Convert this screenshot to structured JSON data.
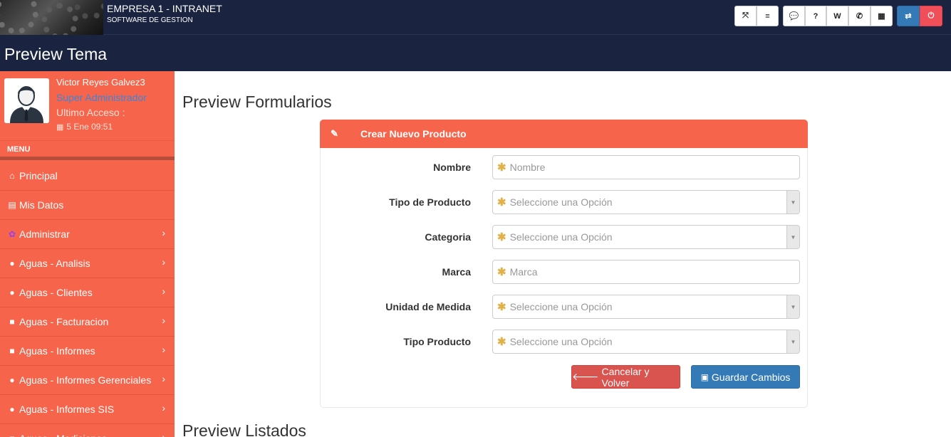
{
  "header": {
    "company": "EMPRESA 1 - INTRANET",
    "subtitle": "SOFTWARE DE GESTION",
    "page_title": "Preview Tema"
  },
  "toolbar": [
    {
      "name": "fullscreen-button",
      "icon": "expand-icon",
      "glyph": "⤧"
    },
    {
      "name": "menu-toggle-button",
      "icon": "hamburger-icon",
      "glyph": "≡"
    },
    {
      "name": "messages-button",
      "icon": "chat-icon",
      "glyph": "💬"
    },
    {
      "name": "help-button",
      "icon": "question-icon",
      "glyph": "?"
    },
    {
      "name": "document-button",
      "icon": "word-doc-icon",
      "glyph": "W"
    },
    {
      "name": "phone-button",
      "icon": "phone-icon",
      "glyph": "✆"
    },
    {
      "name": "calendar-button",
      "icon": "calendar-icon",
      "glyph": "▦"
    },
    {
      "name": "switch-button",
      "icon": "exchange-icon",
      "glyph": "⇄"
    },
    {
      "name": "logout-button",
      "icon": "power-icon",
      "glyph": "⏻"
    }
  ],
  "user": {
    "name": "Victor Reyes Galvez3",
    "role": "Super Administrador",
    "last_access_label": "Ultimo Acceso :",
    "last_access_date": "5 Ene 09:51"
  },
  "sidebar": {
    "menu_label": "MENU",
    "items": [
      {
        "label": "Principal",
        "icon": "home-icon",
        "glyph": "⌂",
        "has_submenu": false
      },
      {
        "label": "Mis Datos",
        "icon": "id-card-icon",
        "glyph": "▤",
        "has_submenu": false
      },
      {
        "label": "Administrar",
        "icon": "gear-icon",
        "glyph": "✿",
        "has_submenu": true
      },
      {
        "label": "Aguas - Analisis",
        "icon": "water-drop-icon",
        "glyph": "●",
        "has_submenu": true
      },
      {
        "label": "Aguas - Clientes",
        "icon": "water-drop-icon",
        "glyph": "●",
        "has_submenu": true
      },
      {
        "label": "Aguas - Facturacion",
        "icon": "report-icon",
        "glyph": "■",
        "has_submenu": true
      },
      {
        "label": "Aguas - Informes",
        "icon": "report-icon",
        "glyph": "■",
        "has_submenu": true
      },
      {
        "label": "Aguas - Informes Gerenciales",
        "icon": "water-drop-icon",
        "glyph": "●",
        "has_submenu": true
      },
      {
        "label": "Aguas - Informes SIS",
        "icon": "water-drop-icon",
        "glyph": "●",
        "has_submenu": true
      },
      {
        "label": "Aguas - Mediciones",
        "icon": "report-icon",
        "glyph": "■",
        "has_submenu": true
      }
    ]
  },
  "main": {
    "forms_heading": "Preview Formularios",
    "lists_heading": "Preview Listados",
    "panel_title": "Crear Nuevo Producto",
    "fields": [
      {
        "label": "Nombre",
        "type": "text",
        "placeholder": "Nombre"
      },
      {
        "label": "Tipo de Producto",
        "type": "select",
        "placeholder": "Seleccione una Opción"
      },
      {
        "label": "Categoria",
        "type": "select",
        "placeholder": "Seleccione una Opción"
      },
      {
        "label": "Marca",
        "type": "text",
        "placeholder": "Marca"
      },
      {
        "label": "Unidad de Medida",
        "type": "select",
        "placeholder": "Seleccione una Opción"
      },
      {
        "label": "Tipo Producto",
        "type": "select",
        "placeholder": "Seleccione una Opción"
      }
    ],
    "cancel_label": "Cancelar y Volver",
    "save_label": "Guardar Cambios"
  },
  "colors": {
    "topbar": "#1a2340",
    "sidebar": "#f6654b",
    "panel_header": "#f6654b",
    "cancel": "#d9534f",
    "save": "#337ab7",
    "role_text": "#3a86d9"
  }
}
